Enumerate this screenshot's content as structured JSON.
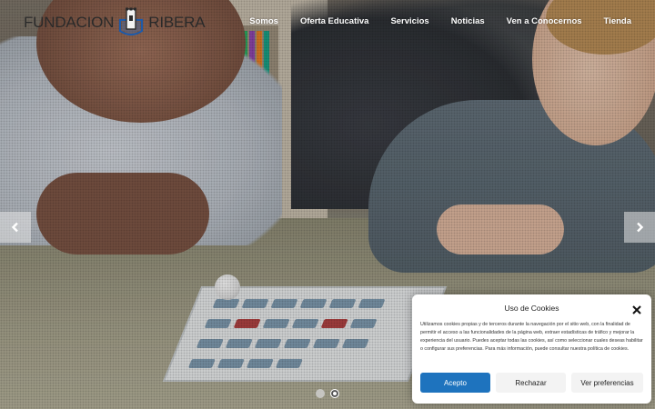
{
  "logo": {
    "text_left": "FUNDACION",
    "text_right": "RIBERA"
  },
  "nav": {
    "items": [
      "Somos",
      "Oferta Educativa",
      "Servicios",
      "Noticias",
      "Ven a Conocernos",
      "Tienda"
    ]
  },
  "slider": {
    "prev_icon": "chevron-left-icon",
    "next_icon": "chevron-right-icon",
    "slides_count": 2,
    "active_slide": 2
  },
  "cookie_banner": {
    "title": "Uso de Cookies",
    "body": "Utilizamos cookies propias y de terceros durante la navegación por el sitio web, con la finalidad de permitir el acceso a las funcionalidades de la página web, extraer estadísticas de tráfico y mejorar la experiencia del usuario. Puedes aceptar todas las cookies, así como seleccionar cuales deseas habilitar o configurar sus preferencias. Para más información, puede consultar nuestra política de cookies.",
    "accept_label": "Acepto",
    "reject_label": "Rechazar",
    "preferences_label": "Ver preferencias",
    "accent_color": "#1e73be"
  }
}
